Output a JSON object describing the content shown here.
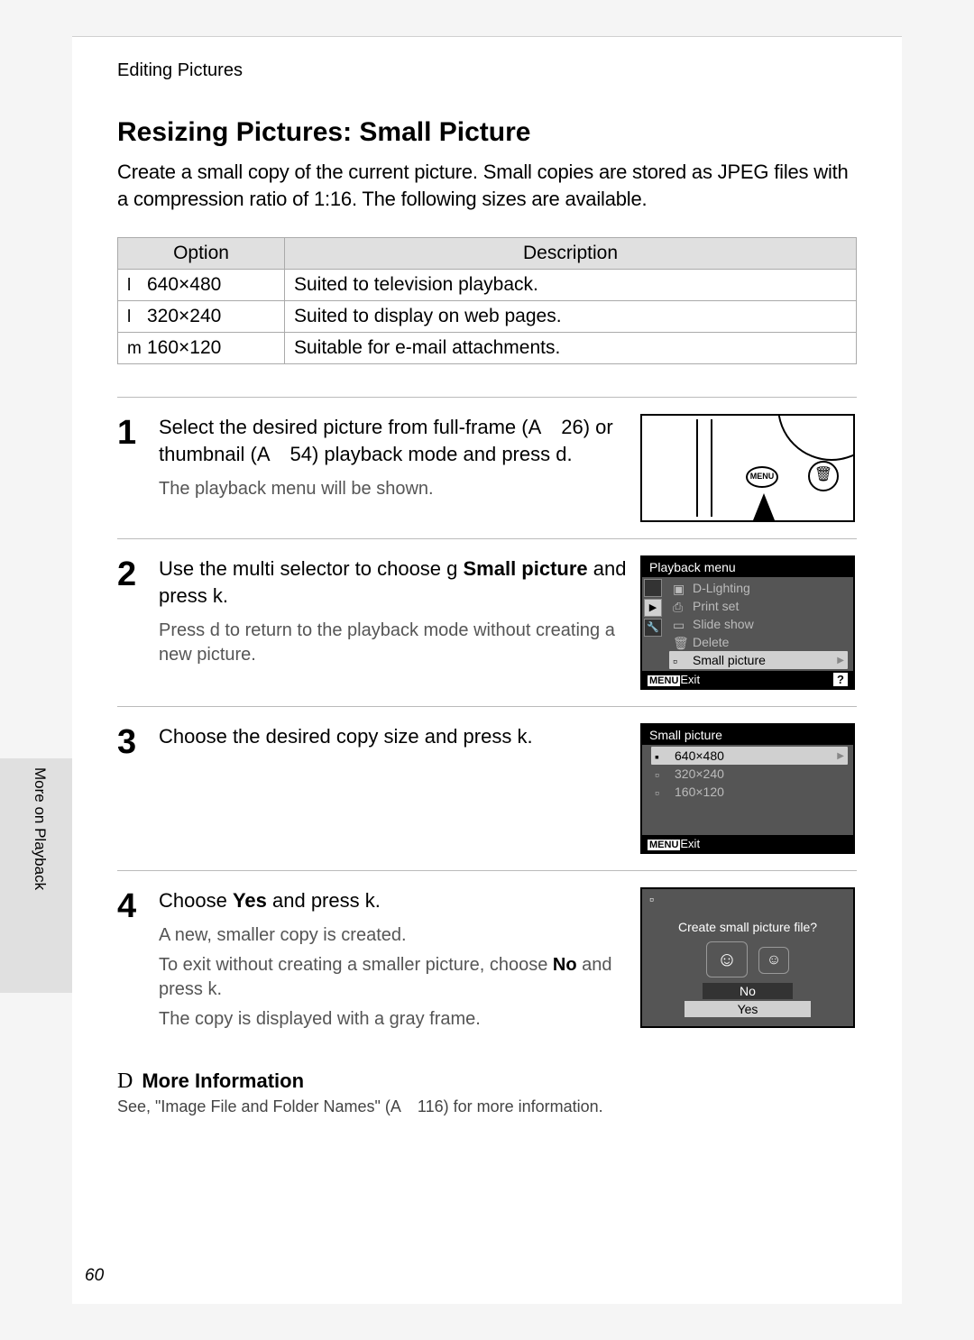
{
  "breadcrumb": "Editing Pictures",
  "section_title": "Resizing Pictures: Small Picture",
  "intro": "Create a small copy of the current picture. Small copies are stored as JPEG files with a compression ratio of 1:16. The following sizes are available.",
  "table": {
    "headers": {
      "option": "Option",
      "description": "Description"
    },
    "rows": [
      {
        "prefix": "l",
        "option": "640×480",
        "desc": "Suited to television playback."
      },
      {
        "prefix": "l",
        "option": "320×240",
        "desc": "Suited to display on web pages."
      },
      {
        "prefix": "m",
        "option": "160×120",
        "desc": "Suitable for e-mail attachments."
      }
    ]
  },
  "steps": {
    "s1": {
      "num": "1",
      "title_a": "Select the desired picture from full-frame (A 26) or thumbnail (A 54) playback mode and press d.",
      "desc": "The playback menu will be shown.",
      "menu_label": "MENU"
    },
    "s2": {
      "num": "2",
      "title_a": "Use the multi selector to choose g ",
      "title_b": "Small picture",
      "title_c": " and press k.",
      "desc_a": "Press ",
      "desc_b": "d",
      "desc_c": " to return to the playback mode without creating a new picture.",
      "lcd_title": "Playback menu",
      "items": [
        {
          "label": "D-Lighting"
        },
        {
          "label": "Print set"
        },
        {
          "label": "Slide show"
        },
        {
          "label": "Delete"
        },
        {
          "label": "Small picture",
          "selected": true
        }
      ],
      "foot_menu": "MENU",
      "foot_exit": "Exit",
      "foot_help": "?"
    },
    "s3": {
      "num": "3",
      "title": "Choose the desired copy size and press k.",
      "lcd_title": "Small picture",
      "items": [
        {
          "label": "640×480",
          "selected": true
        },
        {
          "label": "320×240"
        },
        {
          "label": "160×120"
        }
      ],
      "foot_menu": "MENU",
      "foot_exit": "Exit"
    },
    "s4": {
      "num": "4",
      "title_a": "Choose ",
      "title_b": "Yes",
      "title_c": " and press k.",
      "desc1": "A new, smaller copy is created.",
      "desc2_a": "To exit without creating a smaller picture, choose ",
      "desc2_b": "No",
      "desc2_c": " and press k.",
      "desc3": "The copy is displayed with a gray frame.",
      "lcd_q": "Create small picture file?",
      "no": "No",
      "yes": "Yes"
    }
  },
  "more_info": {
    "d": "D",
    "head": "More Information",
    "body": "See, \"Image File and Folder Names\" (A 116) for more information."
  },
  "side_label": "More on Playback",
  "page_num": "60"
}
